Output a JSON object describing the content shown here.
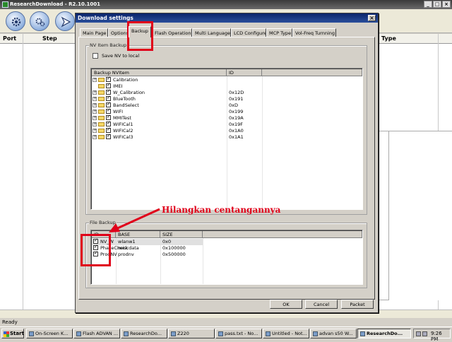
{
  "app": {
    "title": "ResearchDownload - R2.10.1001",
    "columns": [
      "Port",
      "Step",
      "Type"
    ],
    "status": "Ready"
  },
  "dialog": {
    "title": "Download settings",
    "close_glyph": "×",
    "tabs": [
      "Main Page",
      "Options",
      "Backup",
      "Flash Operations",
      "Multi Languages",
      "LCD Configure",
      "MCP Type",
      "Vol-Freq Turnning"
    ],
    "active_tab": "Backup",
    "nv_group": {
      "label": "NV Item Backup",
      "save_to_local_label": "Save NV to local",
      "save_to_local_checked": false,
      "columns": [
        "Backup NVItem",
        "ID"
      ],
      "items": [
        {
          "name": "Calibration",
          "id": "",
          "checked": true,
          "expandable": true
        },
        {
          "name": "IMEI",
          "id": "",
          "checked": true,
          "expandable": false
        },
        {
          "name": "W_Calibration",
          "id": "0x12D",
          "checked": true,
          "expandable": true
        },
        {
          "name": "BlueTooth",
          "id": "0x191",
          "checked": true,
          "expandable": true
        },
        {
          "name": "BandSelect",
          "id": "0xD",
          "checked": true,
          "expandable": true
        },
        {
          "name": "WIFI",
          "id": "0x199",
          "checked": true,
          "expandable": true
        },
        {
          "name": "MMITest",
          "id": "0x19A",
          "checked": true,
          "expandable": true
        },
        {
          "name": "WIFICal1",
          "id": "0x19F",
          "checked": true,
          "expandable": true
        },
        {
          "name": "WIFICal2",
          "id": "0x1A0",
          "checked": true,
          "expandable": true
        },
        {
          "name": "WIFICal3",
          "id": "0x1A1",
          "checked": true,
          "expandable": true
        }
      ]
    },
    "file_group": {
      "label": "File Backup",
      "columns": [
        "ID",
        "BASE",
        "SIZE"
      ],
      "items": [
        {
          "id": "NV_W",
          "base": "wlanw1",
          "size": "0x0",
          "checked": true
        },
        {
          "id": "PhaseCheck",
          "base": "miscdata",
          "size": "0x100000",
          "checked": true
        },
        {
          "id": "ProdNV",
          "base": "prodnv",
          "size": "0x500000",
          "checked": true
        }
      ]
    },
    "buttons": {
      "ok": "OK",
      "cancel": "Cancel",
      "packet": "Packet"
    }
  },
  "annotation": {
    "text": "Hilangkan centangannya",
    "color": "#e0001a"
  },
  "taskbar": {
    "start_label": "Start",
    "tasks": [
      "On-Screen K...",
      "Flash ADVAN ...",
      "ResearchDo...",
      "Z220",
      "pass.txt - No...",
      "Untitled - Not...",
      "advan s50 W...",
      "ResearchDo..."
    ],
    "active_task": 7,
    "clock": "9:26 PM"
  }
}
